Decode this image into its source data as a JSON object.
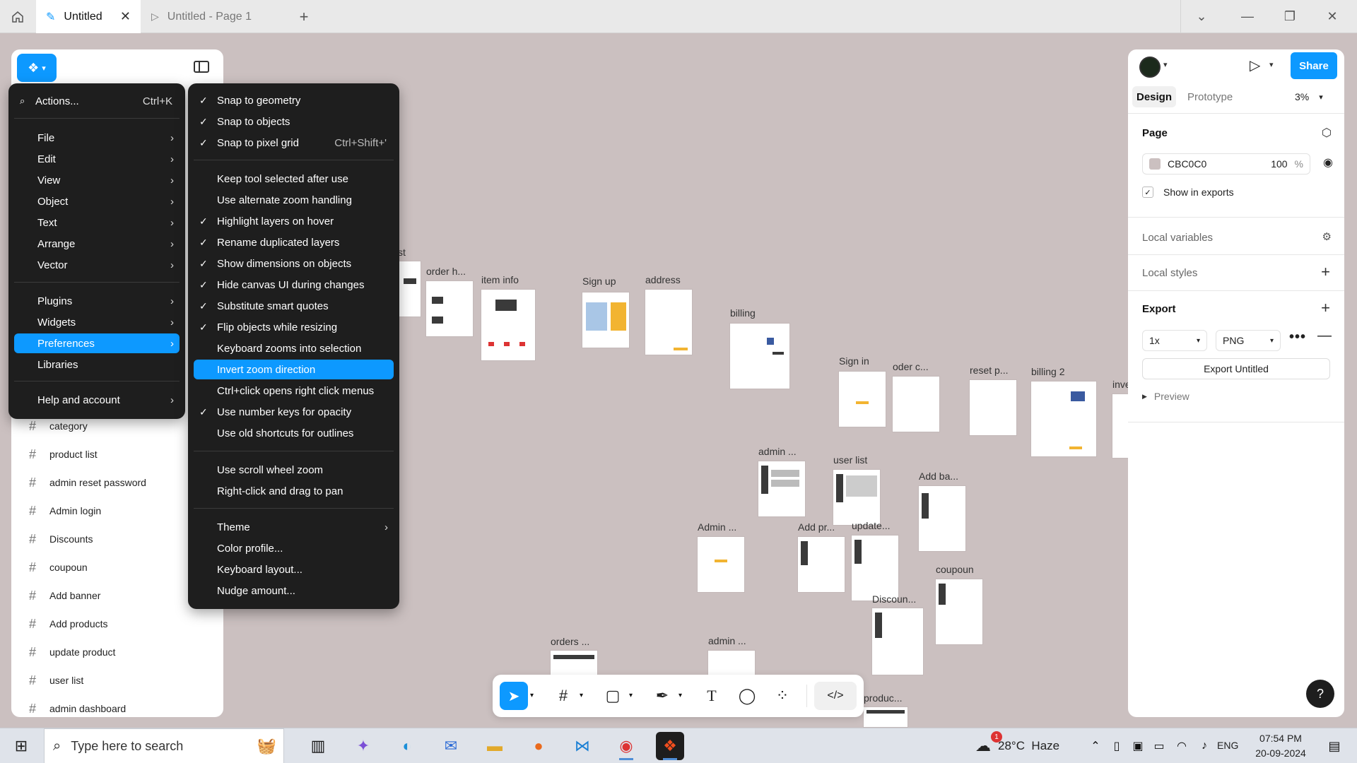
{
  "browser": {
    "tabs": [
      {
        "label": "Untitled",
        "active": true
      },
      {
        "label": "Untitled - Page 1",
        "active": false
      }
    ]
  },
  "canvas": {
    "background": "#cbc0c0",
    "frames": [
      {
        "label": "st"
      },
      {
        "label": "order h..."
      },
      {
        "label": "item info"
      },
      {
        "label": "Sign up"
      },
      {
        "label": "address"
      },
      {
        "label": "billing"
      },
      {
        "label": "Sign in"
      },
      {
        "label": "oder c..."
      },
      {
        "label": "reset p..."
      },
      {
        "label": "billing 2"
      },
      {
        "label": "inve"
      },
      {
        "label": "admin ..."
      },
      {
        "label": "user list"
      },
      {
        "label": "Add ba..."
      },
      {
        "label": "Admin ..."
      },
      {
        "label": "Add pr..."
      },
      {
        "label": "update..."
      },
      {
        "label": "coupoun"
      },
      {
        "label": "Discoun..."
      },
      {
        "label": "orders ..."
      },
      {
        "label": "admin ..."
      },
      {
        "label": "produc..."
      }
    ]
  },
  "layers": [
    "category",
    "product list",
    "admin reset password",
    "Admin login",
    "Discounts",
    "coupoun",
    "Add banner",
    "Add products",
    "update product",
    "user list",
    "admin dashboard"
  ],
  "main_menu": {
    "search_label": "Actions...",
    "search_shortcut": "Ctrl+K",
    "items": [
      {
        "label": "File",
        "submenu": true
      },
      {
        "label": "Edit",
        "submenu": true
      },
      {
        "label": "View",
        "submenu": true
      },
      {
        "label": "Object",
        "submenu": true
      },
      {
        "label": "Text",
        "submenu": true
      },
      {
        "label": "Arrange",
        "submenu": true
      },
      {
        "label": "Vector",
        "submenu": true
      },
      {
        "label": "Plugins",
        "submenu": true
      },
      {
        "label": "Widgets",
        "submenu": true
      },
      {
        "label": "Preferences",
        "submenu": true,
        "highlighted": true
      },
      {
        "label": "Libraries",
        "submenu": false
      },
      {
        "label": "Help and account",
        "submenu": true
      }
    ]
  },
  "preferences_menu": {
    "items": [
      {
        "label": "Snap to geometry",
        "checked": true
      },
      {
        "label": "Snap to objects",
        "checked": true
      },
      {
        "label": "Snap to pixel grid",
        "checked": true,
        "shortcut": "Ctrl+Shift+'"
      },
      {
        "label": "Keep tool selected after use",
        "checked": false
      },
      {
        "label": "Use alternate zoom handling",
        "checked": false
      },
      {
        "label": "Highlight layers on hover",
        "checked": true
      },
      {
        "label": "Rename duplicated layers",
        "checked": true
      },
      {
        "label": "Show dimensions on objects",
        "checked": true
      },
      {
        "label": "Hide canvas UI during changes",
        "checked": true
      },
      {
        "label": "Substitute smart quotes",
        "checked": true
      },
      {
        "label": "Flip objects while resizing",
        "checked": true
      },
      {
        "label": "Keyboard zooms into selection",
        "checked": false
      },
      {
        "label": "Invert zoom direction",
        "checked": false,
        "highlighted": true
      },
      {
        "label": "Ctrl+click opens right click menus",
        "checked": false
      },
      {
        "label": "Use number keys for opacity",
        "checked": true
      },
      {
        "label": "Use old shortcuts for outlines",
        "checked": false
      },
      {
        "label": "Use scroll wheel zoom",
        "checked": false
      },
      {
        "label": "Right-click and drag to pan",
        "checked": false
      },
      {
        "label": "Theme",
        "checked": false,
        "submenu": true
      },
      {
        "label": "Color profile...",
        "checked": false
      },
      {
        "label": "Keyboard layout...",
        "checked": false
      },
      {
        "label": "Nudge amount...",
        "checked": false
      }
    ]
  },
  "right_panel": {
    "share_label": "Share",
    "tabs": {
      "design": "Design",
      "prototype": "Prototype"
    },
    "zoom": "3%",
    "page": {
      "title": "Page",
      "color_hex": "CBC0C0",
      "color": "#cbc0c0",
      "opacity": "100",
      "opacity_unit": "%",
      "show_in_exports": "Show in exports"
    },
    "local_variables": "Local variables",
    "local_styles": "Local styles",
    "export": {
      "title": "Export",
      "scale": "1x",
      "format": "PNG",
      "button": "Export Untitled",
      "preview": "Preview"
    }
  },
  "taskbar": {
    "search_placeholder": "Type here to search",
    "weather": "28°C  Haze",
    "weather_badge": "1",
    "language": "ENG",
    "time": "07:54 PM",
    "date": "20-09-2024"
  },
  "colors": {
    "accent": "#0d99ff",
    "menu_bg": "#1e1e1e"
  }
}
